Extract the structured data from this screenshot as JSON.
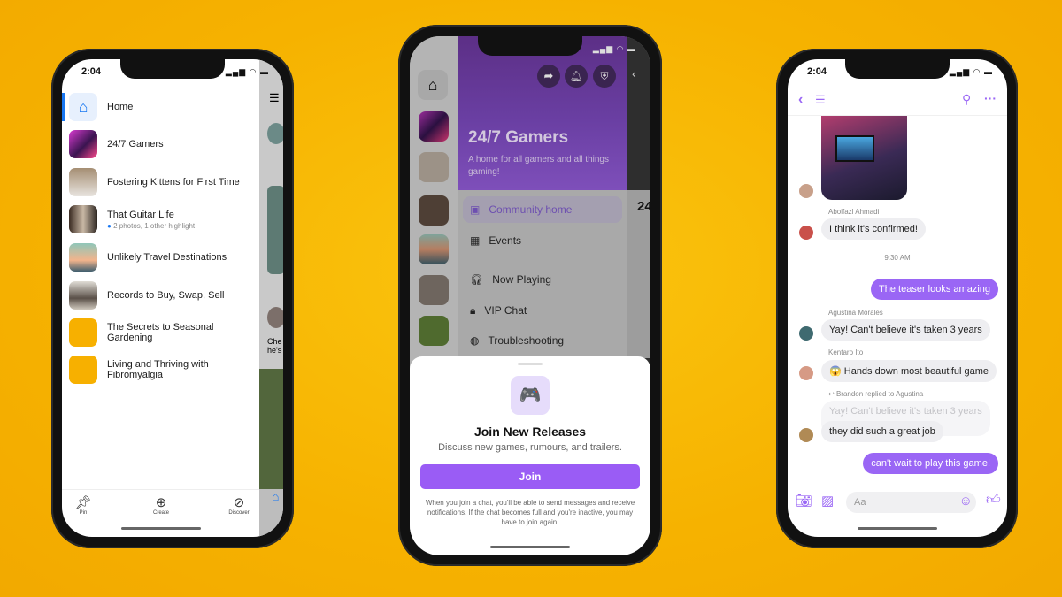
{
  "status_time": "2:04",
  "left_phone": {
    "items": [
      {
        "label": "Home"
      },
      {
        "label": "24/7 Gamers"
      },
      {
        "label": "Fostering Kittens for First Time"
      },
      {
        "label": "That Guitar Life",
        "sub": "2 photos, 1 other highlight"
      },
      {
        "label": "Unlikely Travel Destinations"
      },
      {
        "label": "Records to Buy, Swap, Sell"
      },
      {
        "label": "The Secrets to Seasonal Gardening"
      },
      {
        "label": "Living and Thriving with Fibromyalgia"
      }
    ],
    "peek_text": "Che he's",
    "tabs": [
      {
        "label": "Pin",
        "icon": "pin-icon"
      },
      {
        "label": "Create",
        "icon": "plus-circle-icon"
      },
      {
        "label": "Discover",
        "icon": "discover-icon"
      }
    ],
    "accent": "#1877f2"
  },
  "middle_phone": {
    "community_title": "24/7 Gamers",
    "community_desc": "A home for all gamers and all things gaming!",
    "peek_text": "24",
    "menu": [
      {
        "label": "Community home",
        "icon": "community-home-icon"
      },
      {
        "label": "Events",
        "icon": "calendar-icon"
      },
      {
        "label": "Now Playing",
        "icon": "headphones-icon"
      },
      {
        "label": "VIP Chat",
        "icon": "lock-chat-icon"
      },
      {
        "label": "Troubleshooting",
        "icon": "globe-chat-icon"
      }
    ],
    "sheet": {
      "icon": "🎮",
      "title": "Join New Releases",
      "subtitle": "Discuss new games, rumours, and trailers.",
      "button": "Join",
      "note": "When you join a chat, you'll be able to send messages and receive notifications. If the chat becomes full and you're inactive, you may have to join again."
    },
    "accent": "#9a5cf5"
  },
  "right_phone": {
    "messages": [
      {
        "sender": "Abolfazl Ahmadi",
        "text": "I think it's confirmed!"
      },
      {
        "timestamp": "9:30 AM"
      },
      {
        "mine": true,
        "text": "The teaser looks amazing"
      },
      {
        "sender": "Agustina Morales",
        "text": "Yay! Can't believe it's taken 3 years"
      },
      {
        "sender": "Kentaro Ito",
        "text": "😱 Hands down most beautiful game"
      },
      {
        "reply_label": "Brandon replied to Agustina",
        "quoted": "Yay! Can't believe it's taken 3 years",
        "text": "they did such a great job"
      },
      {
        "mine": true,
        "text": "can't wait to play this game!"
      }
    ],
    "input_placeholder": "Aa",
    "accent": "#9a66f5"
  }
}
